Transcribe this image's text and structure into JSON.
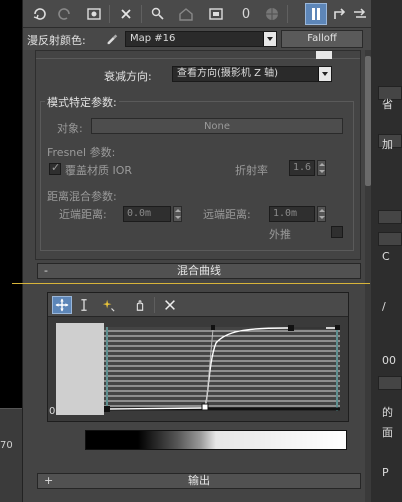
{
  "toolbar": {
    "buttons": [
      {
        "name": "get-material-icon",
        "glyph": "↻"
      },
      {
        "name": "put-to-scene-icon",
        "glyph": "↺"
      },
      {
        "name": "assign-material-icon",
        "glyph": "▣"
      },
      {
        "name": "reset-icon",
        "glyph": "✕"
      },
      {
        "name": "make-unique-icon",
        "glyph": "⚲"
      },
      {
        "name": "put-to-library-icon",
        "glyph": "⌂"
      },
      {
        "name": "material-effects-channel-icon",
        "glyph": "▤"
      },
      {
        "name": "channel-number",
        "glyph": "0"
      },
      {
        "name": "show-map-icon",
        "glyph": "◉"
      },
      {
        "name": "show-end-result-icon",
        "glyph": "▮"
      },
      {
        "name": "go-to-parent-icon",
        "glyph": "⤴"
      },
      {
        "name": "go-forward-sibling-icon",
        "glyph": "⇆"
      }
    ]
  },
  "diffuse": {
    "label": "漫反射颜色:",
    "map_value": "Map #16",
    "type_button": "Falloff"
  },
  "falloff_direction": {
    "label": "衰减方向:",
    "value": "查看方向(摄影机 Z 轴)"
  },
  "mode_params": {
    "title": "模式特定参数:",
    "object_label": "对象:",
    "object_value": "None",
    "fresnel_title": "Fresnel 参数:",
    "override_ior_label": "覆盖材质 IOR",
    "ior_label": "折射率",
    "ior_value": "1.6",
    "distance_title": "距离混合参数:",
    "near_label": "近端距离:",
    "near_value": "0.0m",
    "far_label": "远端距离:",
    "far_value": "1.0m",
    "extrapolate_label": "外推"
  },
  "mix_curve": {
    "title": "混合曲线",
    "collapse_symbol": "-",
    "axis_zero": "0",
    "colors": {
      "selected_tool": "#5d86b8",
      "curve": "#ffffff"
    }
  },
  "output": {
    "title": "输出",
    "expand_symbol": "+"
  },
  "background": {
    "left_number": "70",
    "right_fragments": [
      "省",
      "加",
      "C",
      "/",
      "00",
      "的",
      "面",
      "P"
    ]
  }
}
